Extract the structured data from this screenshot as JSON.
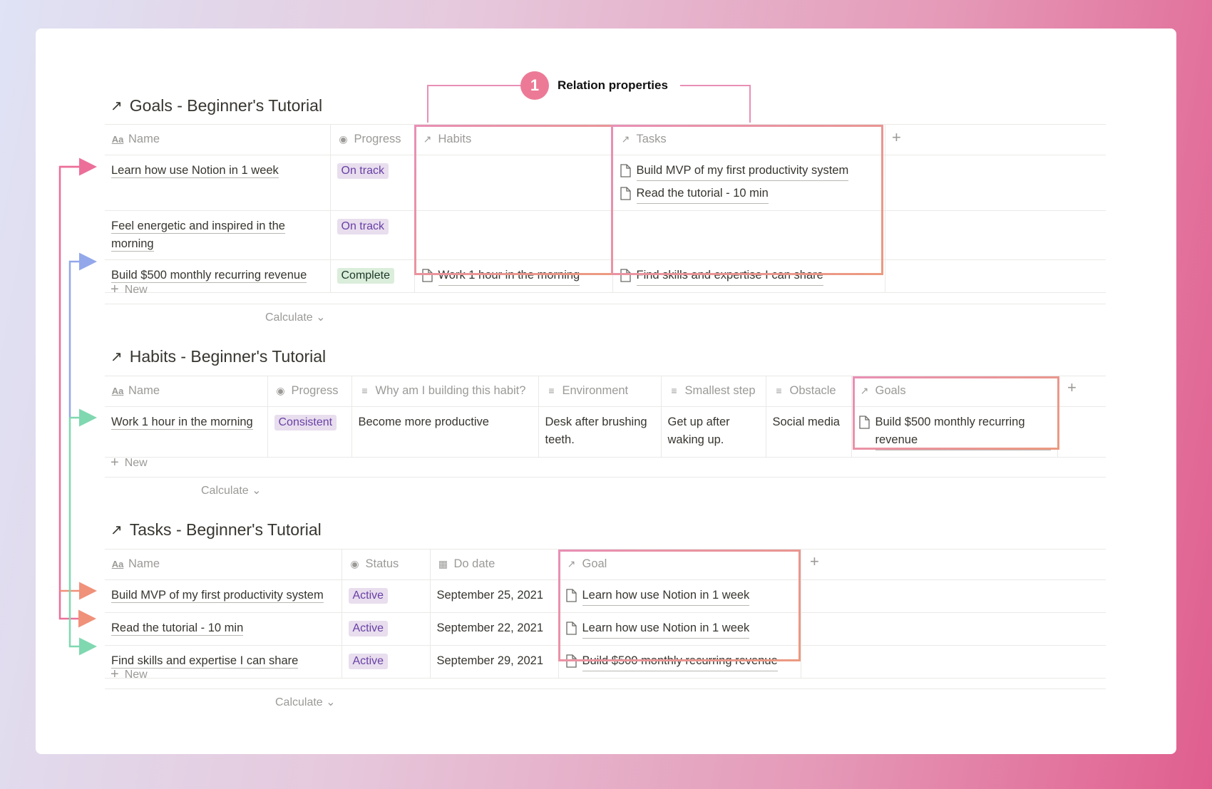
{
  "callout": {
    "number": "1",
    "label": "Relation properties"
  },
  "goals": {
    "title": "Goals - Beginner's Tutorial",
    "headers": {
      "name": "Name",
      "progress": "Progress",
      "habits": "Habits",
      "tasks": "Tasks"
    },
    "rows": [
      {
        "name": "Learn how use Notion in 1 week",
        "progress": "On track",
        "habits": [],
        "tasks": [
          "Build MVP of my first productivity system",
          "Read the tutorial - 10 min"
        ]
      },
      {
        "name": "Feel energetic and inspired in the morning",
        "progress": "On track",
        "habits": [],
        "tasks": []
      },
      {
        "name": "Build $500 monthly recurring revenue",
        "progress": "Complete",
        "habits": [
          "Work 1 hour in the morning"
        ],
        "tasks": [
          "Find skills and expertise I can share"
        ]
      }
    ],
    "new_label": "New",
    "calculate_label": "Calculate"
  },
  "habits": {
    "title": "Habits - Beginner's Tutorial",
    "headers": {
      "name": "Name",
      "progress": "Progress",
      "why": "Why am I building this habit?",
      "environment": "Environment",
      "smallest_step": "Smallest step",
      "obstacle": "Obstacle",
      "goals": "Goals"
    },
    "rows": [
      {
        "name": "Work 1 hour in the morning",
        "progress": "Consistent",
        "why": "Become more productive",
        "environment": "Desk after brushing teeth.",
        "smallest_step": "Get up after waking up.",
        "obstacle": "Social media",
        "goals": "Build $500 monthly recurring revenue"
      }
    ],
    "new_label": "New",
    "calculate_label": "Calculate"
  },
  "tasks": {
    "title": "Tasks - Beginner's Tutorial",
    "headers": {
      "name": "Name",
      "status": "Status",
      "do_date": "Do date",
      "goal": "Goal"
    },
    "rows": [
      {
        "name": "Build MVP of my first productivity system",
        "status": "Active",
        "do_date": "September 25, 2021",
        "goal": "Learn how use Notion in 1 week"
      },
      {
        "name": "Read the tutorial - 10 min",
        "status": "Active",
        "do_date": "September 22, 2021",
        "goal": "Learn how use Notion in 1 week"
      },
      {
        "name": "Find skills and expertise I can share",
        "status": "Active",
        "do_date": "September 29, 2021",
        "goal": "Build $500 monthly recurring revenue"
      }
    ],
    "new_label": "New",
    "calculate_label": "Calculate"
  },
  "colors": {
    "connector_pink": "#ec6f9a",
    "connector_blue": "#93a8ea",
    "connector_green": "#7fd8b0",
    "connector_coral": "#f0917a",
    "highlight_border": "#e98fb5",
    "badge": "#ec7a96"
  }
}
